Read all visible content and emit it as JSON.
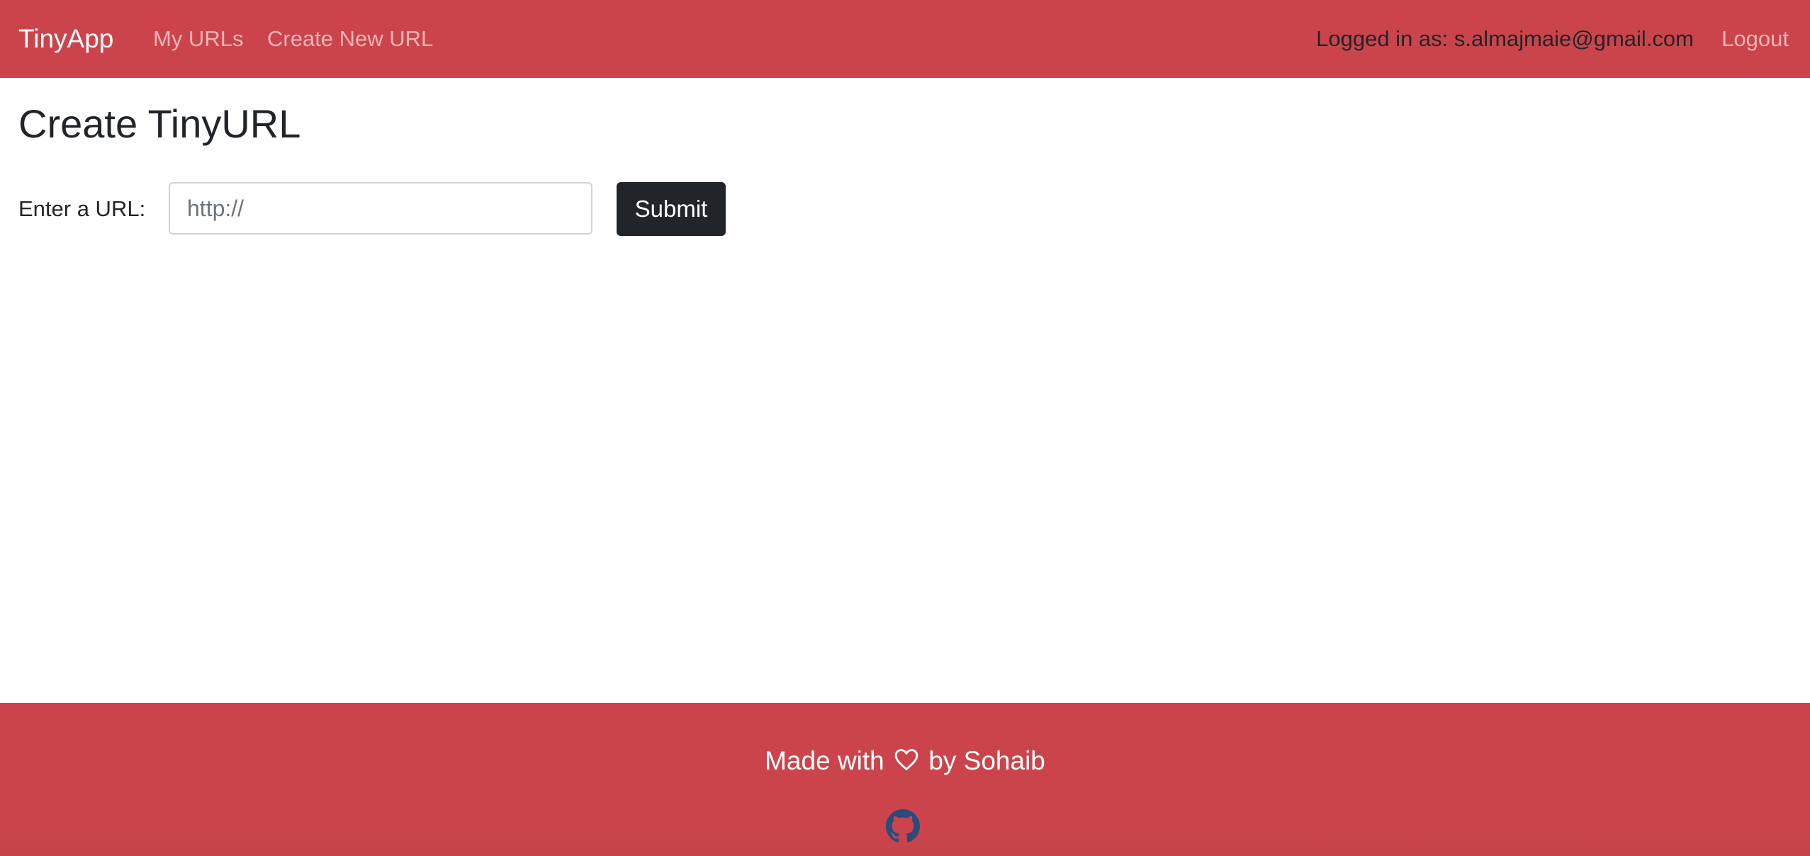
{
  "navbar": {
    "brand": "TinyApp",
    "links": {
      "my_urls": "My URLs",
      "create_new_url": "Create New URL"
    },
    "logged_in_text": "Logged in as: s.almajmaie@gmail.com",
    "logout": "Logout"
  },
  "main": {
    "title": "Create TinyURL",
    "form": {
      "label": "Enter a URL:",
      "input_value": "",
      "input_placeholder": "http://",
      "submit_label": "Submit"
    }
  },
  "footer": {
    "text_before": "Made with",
    "text_after": "by Sohaib",
    "heart_icon": "heart-outline-icon",
    "github_icon": "github-icon"
  },
  "colors": {
    "brand_red": "#cc444b",
    "button_dark": "#212529",
    "github_blue": "#2a4b7c"
  }
}
